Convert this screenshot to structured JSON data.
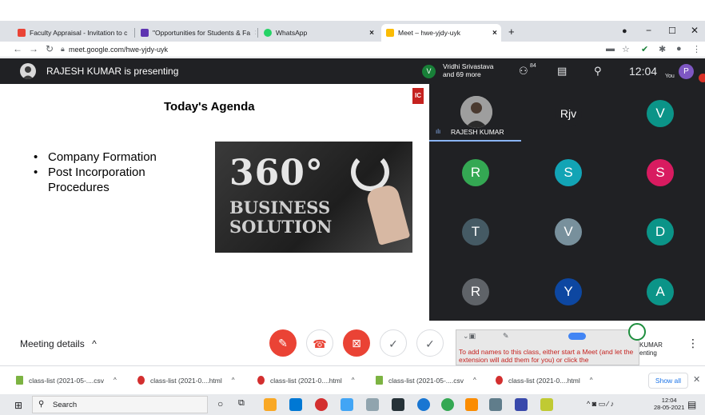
{
  "browser": {
    "tabs": [
      {
        "label": "Faculty Appraisal - Invitation to c",
        "color": "#ea4335"
      },
      {
        "label": "\"Opportunities for Students & Fa",
        "color": "#5e35b1"
      },
      {
        "label": "WhatsApp",
        "color": "#25d366"
      },
      {
        "label": "Meet – hwe-yjdy-uyk",
        "color": "#fbbc04"
      }
    ],
    "new_tab": "+",
    "url": "meet.google.com/hwe-yjdy-uyk"
  },
  "meet": {
    "presenting_text": "RAJESH KUMAR is presenting",
    "participant_summary_name": "Vridhi Srivastava",
    "participant_summary_more": "and 69 more",
    "participant_avatar_letter": "V",
    "people_count": "84",
    "clock": "12:04",
    "you_label": "You",
    "user_avatar_letter": "P",
    "presenter_name": "RAJESH KUMAR",
    "participants": [
      {
        "letter": "Rjv",
        "color": "#202124"
      },
      {
        "letter": "V",
        "color": "#0b9488"
      },
      {
        "letter": "R",
        "color": "#34a853"
      },
      {
        "letter": "S",
        "color": "#12a4b5"
      },
      {
        "letter": "S",
        "color": "#d81b60"
      },
      {
        "letter": "T",
        "color": "#455a64"
      },
      {
        "letter": "V",
        "color": "#78909c"
      },
      {
        "letter": "D",
        "color": "#0b9488"
      },
      {
        "letter": "R",
        "color": "#5f6368"
      },
      {
        "letter": "Y",
        "color": "#0d47a1"
      },
      {
        "letter": "A",
        "color": "#0b9488"
      }
    ],
    "meeting_details": "Meeting details",
    "extension_text": "To add names to this class, either start a Meet (and let the extension will add them for you) or click the",
    "presenter_fragment_line1": "KUMAR",
    "presenter_fragment_line2": "enting"
  },
  "slide": {
    "title": "Today's Agenda",
    "bullets": [
      "Company Formation",
      "Post Incorporation Procedures"
    ],
    "image_line1": "360°",
    "image_line2": "BUSINESS",
    "image_line3": "SOLUTION",
    "logo": "IC"
  },
  "downloads": {
    "items": [
      {
        "label": "class-list (2021-05-....csv",
        "color": "#7cb342"
      },
      {
        "label": "class-list (2021-0....html",
        "color": "#d32f2f"
      },
      {
        "label": "class-list (2021-0....html",
        "color": "#d32f2f"
      },
      {
        "label": "class-list (2021-05-....csv",
        "color": "#7cb342"
      },
      {
        "label": "class-list (2021-0....html",
        "color": "#d32f2f"
      }
    ],
    "show_all": "Show all"
  },
  "taskbar": {
    "search_label": "Search",
    "time": "12:04",
    "date": "28-05-2021"
  }
}
